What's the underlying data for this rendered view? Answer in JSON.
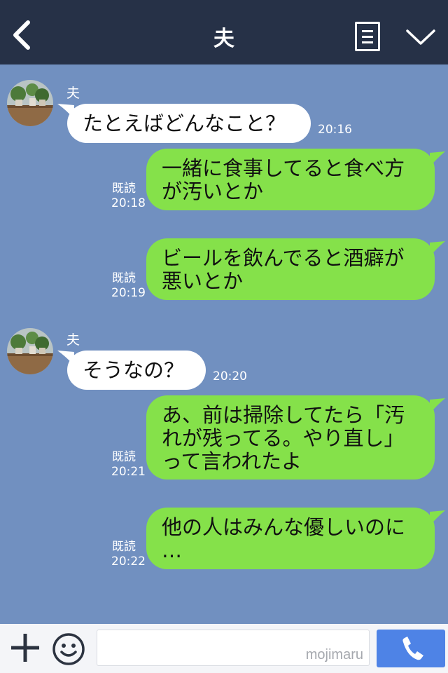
{
  "header": {
    "title": "夫",
    "icons": [
      "chevron-left-icon",
      "notes-icon",
      "chevron-down-icon"
    ]
  },
  "colors": {
    "header_bg": "#263147",
    "chat_bg": "#7190c0",
    "incoming_bubble": "#ffffff",
    "outgoing_bubble": "#85e14a",
    "call_button": "#4e83e6"
  },
  "messages": [
    {
      "direction": "in",
      "sender": "夫",
      "lines": [
        "たとえばどんなこと？"
      ],
      "time": "20:16"
    },
    {
      "direction": "out",
      "read": "既読",
      "lines": [
        "一緒に食事してると食べ方",
        "が汚いとか"
      ],
      "time": "20:18"
    },
    {
      "direction": "out",
      "read": "既読",
      "lines": [
        "ビールを飲んでると酒癖が",
        "悪いとか"
      ],
      "time": "20:19"
    },
    {
      "direction": "in",
      "sender": "夫",
      "lines": [
        "そうなの？"
      ],
      "time": "20:20"
    },
    {
      "direction": "out",
      "read": "既読",
      "lines": [
        "あ、前は掃除してたら「汚",
        "れが残ってる。やり直し」",
        "って言われたよ"
      ],
      "time": "20:21"
    },
    {
      "direction": "out",
      "read": "既読",
      "lines": [
        "他の人はみんな優しいのに",
        "…"
      ],
      "time": "20:22"
    }
  ],
  "footer": {
    "watermark": "mojimaru",
    "icons": [
      "plus-icon",
      "emoji-icon",
      "phone-icon"
    ]
  }
}
